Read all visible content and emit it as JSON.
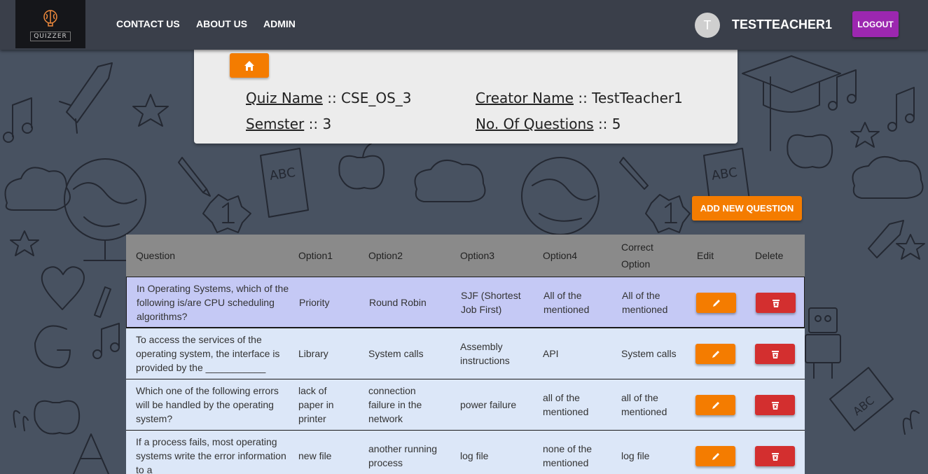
{
  "navbar": {
    "logo_text": "QUIZZER",
    "links": [
      "CONTACT US",
      "ABOUT US",
      "ADMIN"
    ],
    "avatar_letter": "T",
    "username": "TESTTEACHER1",
    "logout_label": "LOGOUT"
  },
  "quiz_info": {
    "quiz_name_label": "Quiz Name",
    "quiz_name_value": ":: CSE_OS_3",
    "creator_label": "Creator Name",
    "creator_value": ":: TestTeacher1",
    "semester_label": "Semster",
    "semester_value": ":: 3",
    "num_questions_label": "No. Of Questions",
    "num_questions_value": ":: 5"
  },
  "add_button_label": "ADD NEW QUESTION",
  "table": {
    "headers": [
      "Question",
      "Option1",
      "Option2",
      "Option3",
      "Option4",
      "Correct Option",
      "Edit",
      "Delete"
    ],
    "rows": [
      {
        "question": "In Operating Systems, which of the following is/are CPU scheduling algorithms?",
        "option1": "Priority",
        "option2": "Round Robin",
        "option3": "SJF (Shortest Job First)",
        "option4": "All of the mentioned",
        "correct": "All of the mentioned"
      },
      {
        "question": "To access the services of the operating system, the interface is provided by the ___________",
        "option1": "Library",
        "option2": "System calls",
        "option3": "Assembly instructions",
        "option4": "API",
        "correct": "System calls"
      },
      {
        "question": "Which one of the following errors will be handled by the operating system?",
        "option1": "lack of paper in printer",
        "option2": "connection failure in the network",
        "option3": "power failure",
        "option4": "all of the mentioned",
        "correct": "all of the mentioned"
      },
      {
        "question": "If a process fails, most operating systems write the error information to a ______",
        "option1": "new file",
        "option2": "another running process",
        "option3": "log file",
        "option4": "none of the mentioned",
        "correct": "log file"
      }
    ]
  },
  "colors": {
    "background": "#485261",
    "navbar": "#3a3f4a",
    "orange": "#f47c00",
    "logout_purple": "#9c27b0",
    "delete_red": "#d32f2f",
    "header_gray": "#8a8a8a",
    "row_blue": "#dce7f8",
    "row_selected": "#c5c9f5"
  },
  "icons": {
    "home": "home-icon",
    "edit": "pencil-icon",
    "delete": "trash-icon",
    "logo": "brain-icon"
  }
}
